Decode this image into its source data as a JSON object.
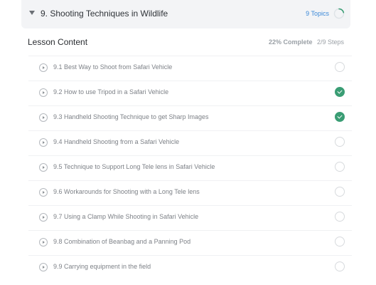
{
  "section": {
    "title": "9. Shooting Techniques in Wildlife",
    "topics": "9 Topics",
    "progress_fraction": 0.22
  },
  "lesson_header": {
    "title": "Lesson Content",
    "percent_complete": "22% Complete",
    "steps": "2/9 Steps"
  },
  "lessons": [
    {
      "label": "9.1 Best Way to Shoot from Safari Vehicle",
      "completed": false
    },
    {
      "label": "9.2 How to use Tripod in a Safari Vehicle",
      "completed": true
    },
    {
      "label": "9.3 Handheld Shooting Technique to get Sharp Images",
      "completed": true
    },
    {
      "label": "9.4 Handheld Shooting from a Safari Vehicle",
      "completed": false
    },
    {
      "label": "9.5 Technique to Support Long Tele lens in Safari Vehicle",
      "completed": false
    },
    {
      "label": "9.6 Workarounds for Shooting with a Long Tele lens",
      "completed": false
    },
    {
      "label": "9.7 Using a Clamp While Shooting in Safari Vehicle",
      "completed": false
    },
    {
      "label": "9.8 Combination of Beanbag and a Panning Pod",
      "completed": false
    },
    {
      "label": "9.9 Carrying equipment in the field",
      "completed": false
    }
  ],
  "colors": {
    "accent_blue": "#3d8ad8",
    "complete_green": "#3a9d74"
  }
}
